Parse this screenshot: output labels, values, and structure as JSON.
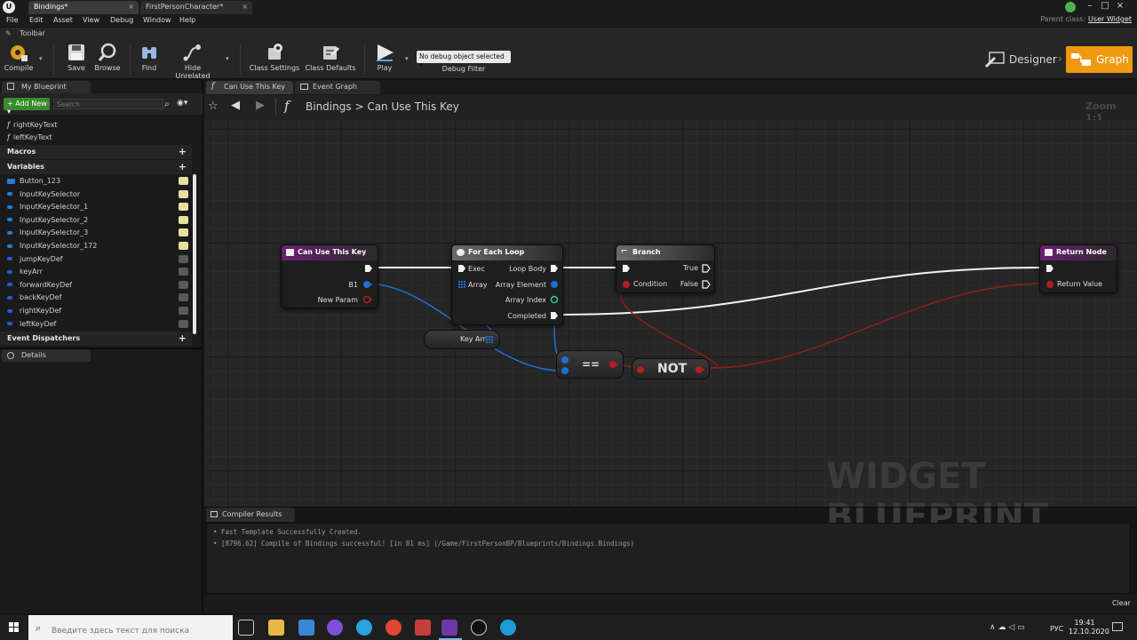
{
  "window": {
    "tabs": [
      {
        "label": "Bindings*"
      },
      {
        "label": "FirstPersonCharacter*"
      }
    ],
    "parent_class_label": "Parent class:",
    "parent_class_value": "User Widget"
  },
  "menu": [
    "File",
    "Edit",
    "Asset",
    "View",
    "Debug",
    "Window",
    "Help"
  ],
  "toolbar": {
    "header": "Toolbar",
    "compile": "Compile",
    "save": "Save",
    "browse": "Browse",
    "find": "Find",
    "hide_unrelated": "Hide Unrelated",
    "class_settings": "Class Settings",
    "class_defaults": "Class Defaults",
    "play": "Play",
    "debug_select": "No debug object selected",
    "debug_filter": "Debug Filter",
    "designer": "Designer",
    "graph": "Graph"
  },
  "my_blueprint": {
    "tab": "My Blueprint",
    "add_new": "Add New",
    "search_placeholder": "Search",
    "functions": [
      "rightKeyText",
      "leftKeyText"
    ],
    "macros_label": "Macros",
    "variables_label": "Variables",
    "variables": [
      {
        "name": "Button_123",
        "color": "#1f7fd1"
      },
      {
        "name": "InputKeySelector",
        "color": "#1f7fd1"
      },
      {
        "name": "InputKeySelector_1",
        "color": "#1f7fd1"
      },
      {
        "name": "InputKeySelector_2",
        "color": "#1f7fd1"
      },
      {
        "name": "InputKeySelector_3",
        "color": "#1f7fd1"
      },
      {
        "name": "InputKeySelector_172",
        "color": "#1f7fd1"
      },
      {
        "name": "jumpKeyDef",
        "color": "#1f5fd1"
      },
      {
        "name": "keyArr",
        "color": "#1f5fd1"
      },
      {
        "name": "forwardKeyDef",
        "color": "#1f5fd1"
      },
      {
        "name": "backKeyDef",
        "color": "#1f5fd1"
      },
      {
        "name": "rightKeyDef",
        "color": "#1f5fd1"
      },
      {
        "name": "leftKeyDef",
        "color": "#1f5fd1"
      }
    ],
    "event_dispatchers_label": "Event Dispatchers"
  },
  "details": {
    "tab": "Details"
  },
  "graph": {
    "tabs": [
      {
        "label": "Can Use This Key"
      },
      {
        "label": "Event Graph"
      }
    ],
    "breadcrumb_root": "Bindings",
    "breadcrumb_sep": ">",
    "breadcrumb_leaf": "Can Use This Key",
    "zoom": "Zoom 1:1",
    "watermark": "WIDGET BLUEPRINT",
    "nodes": {
      "entry": {
        "title": "Can Use This Key",
        "pin1": "B1",
        "pin2": "New Param"
      },
      "foreach": {
        "title": "For Each Loop",
        "exec": "Exec",
        "array": "Array",
        "loop_body": "Loop Body",
        "array_element": "Array Element",
        "array_index": "Array Index",
        "completed": "Completed"
      },
      "branch": {
        "title": "Branch",
        "condition": "Condition",
        "true": "True",
        "false": "False"
      },
      "return": {
        "title": "Return Node",
        "return_value": "Return Value"
      },
      "keyarr": {
        "label": "Key Arr"
      },
      "equals": {
        "label": "=="
      },
      "not": {
        "label": "NOT"
      }
    }
  },
  "compiler": {
    "tab": "Compiler Results",
    "lines": [
      "Fast Template Successfully Created.",
      "[8796.62] Compile of Bindings successful! [in 81 ms] (/Game/FirstPersonBP/Blueprints/Bindings.Bindings)"
    ],
    "clear": "Clear"
  },
  "taskbar": {
    "search_placeholder": "Введите здесь текст для поиска",
    "lang": "РУС",
    "time": "19:41",
    "date": "12.10.2020"
  },
  "colors": {
    "accent_orange": "#f19a10",
    "exec_wire": "#ffffff",
    "bool_wire": "#8b1e1e",
    "struct_wire": "#1e6fd1",
    "function_header": "#6a1b6e"
  }
}
